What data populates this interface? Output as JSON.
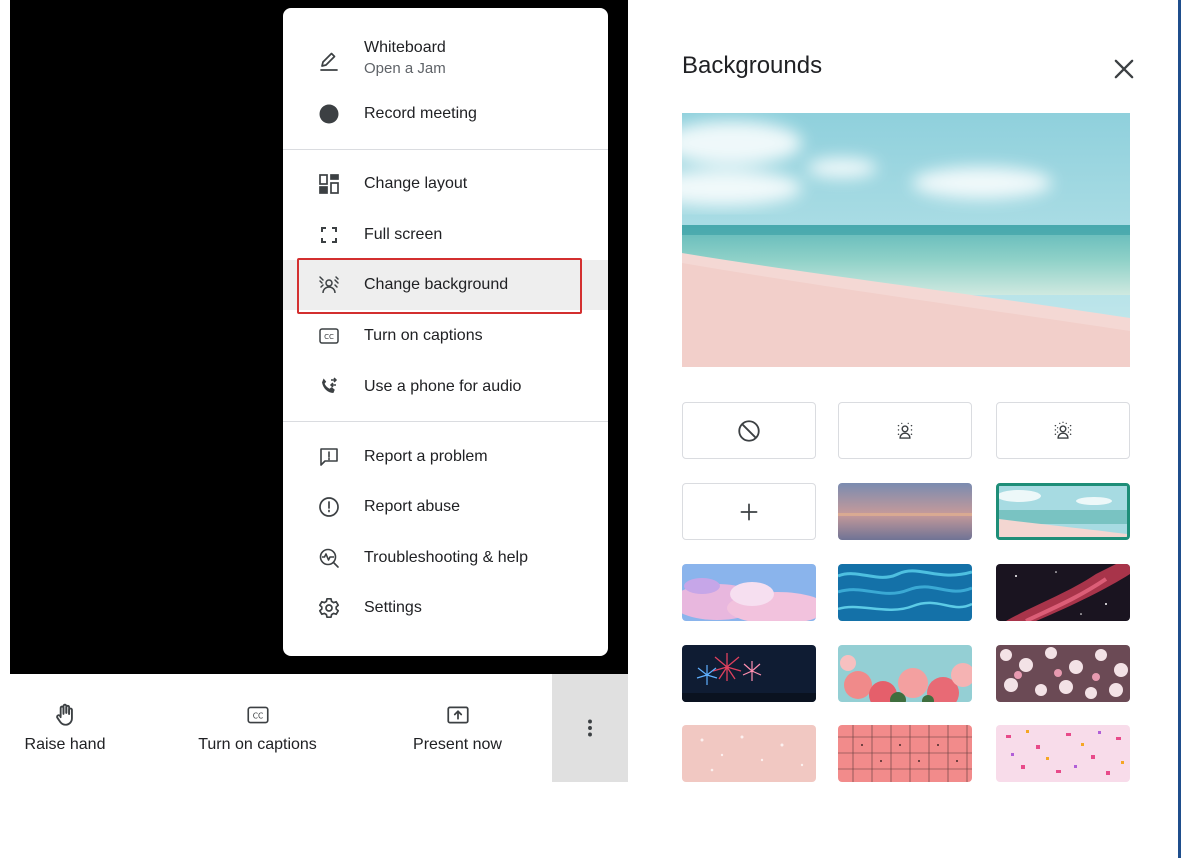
{
  "toolbar": {
    "raise_hand": "Raise hand",
    "captions": "Turn on captions",
    "present": "Present now"
  },
  "menu": {
    "whiteboard": "Whiteboard",
    "whiteboard_sub": "Open a Jam",
    "record": "Record meeting",
    "layout": "Change layout",
    "fullscreen": "Full screen",
    "background": "Change background",
    "captions": "Turn on captions",
    "phone": "Use a phone for audio",
    "report_problem": "Report a problem",
    "report_abuse": "Report abuse",
    "troubleshoot": "Troubleshooting & help",
    "settings": "Settings"
  },
  "panel": {
    "title": "Backgrounds"
  },
  "colors": {
    "highlight": "#d32f2f",
    "selected": "#1e8e78",
    "frame": "#1f4e8c"
  },
  "icons": [
    "pen-icon",
    "record-dot-icon",
    "layout-icon",
    "fullscreen-icon",
    "background-icon",
    "captions-icon",
    "phone-icon",
    "feedback-icon",
    "alert-circle-icon",
    "troubleshoot-icon",
    "gear-icon",
    "hand-icon",
    "present-icon",
    "more-vert-icon",
    "close-icon",
    "no-effect-icon",
    "blur-icon",
    "add-icon"
  ]
}
